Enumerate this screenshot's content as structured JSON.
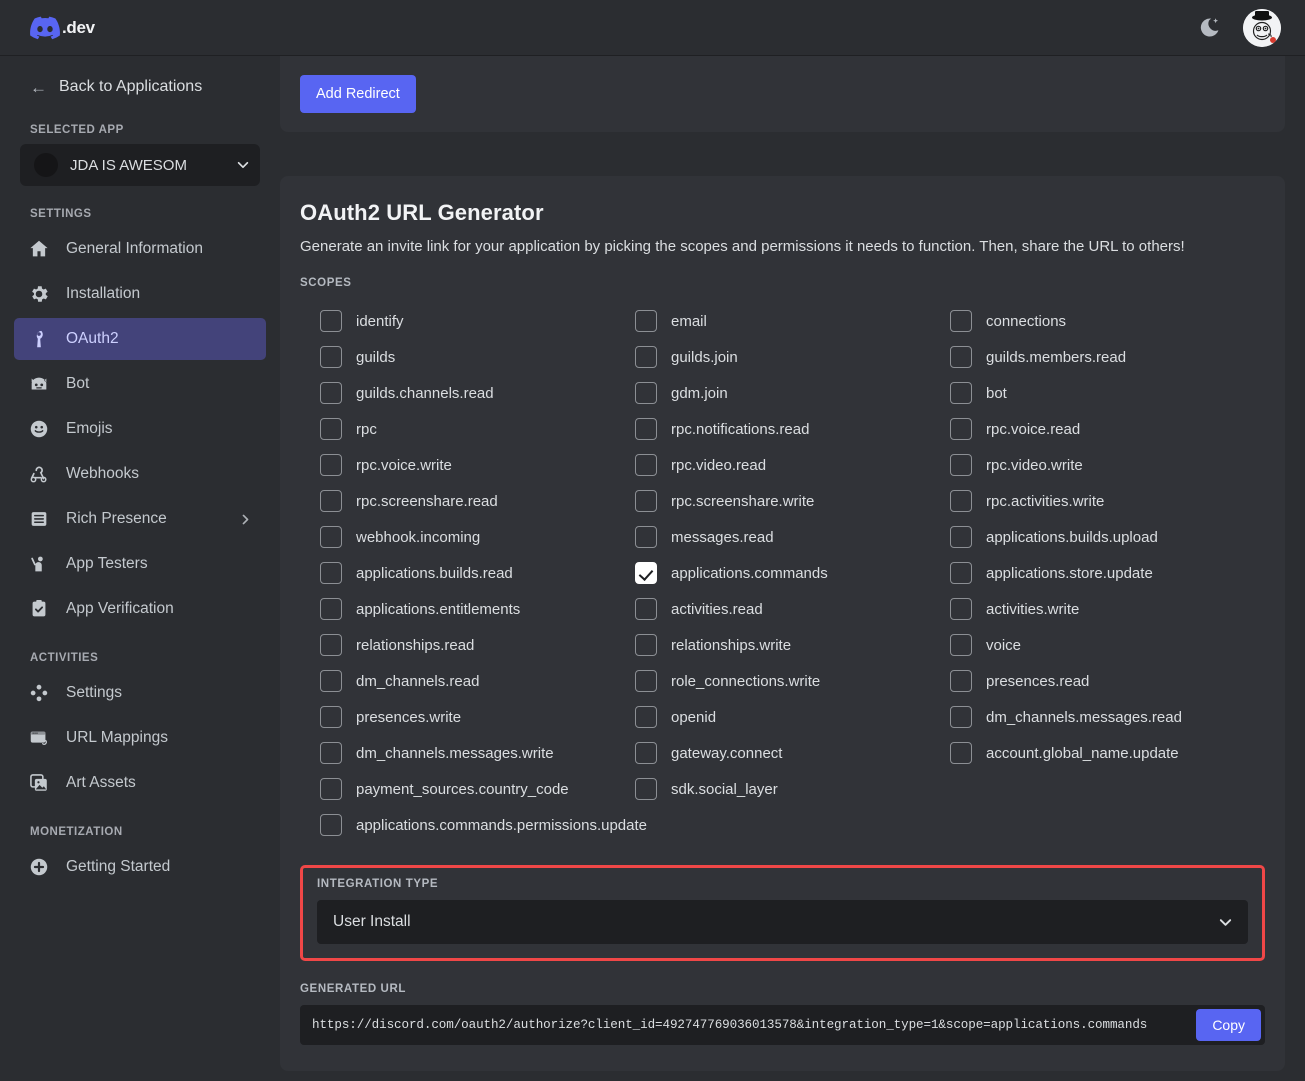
{
  "topbar": {
    "brand_suffix": ".dev",
    "logo_icon": "discord-logo-icon",
    "theme_toggle_icon": "moon-icon",
    "avatar_icon": "user-avatar"
  },
  "sidebar": {
    "back_label": "Back to Applications",
    "back_icon": "arrow-left-icon",
    "selected_app_heading": "SELECTED APP",
    "selected_app_name": "JDA IS AWESOM",
    "settings_heading": "SETTINGS",
    "settings_items": [
      {
        "label": "General Information",
        "icon": "home-icon",
        "active": false
      },
      {
        "label": "Installation",
        "icon": "gear-icon",
        "active": false
      },
      {
        "label": "OAuth2",
        "icon": "wrench-icon",
        "active": true
      },
      {
        "label": "Bot",
        "icon": "bot-icon",
        "active": false
      },
      {
        "label": "Emojis",
        "icon": "smiley-icon",
        "active": false
      },
      {
        "label": "Webhooks",
        "icon": "webhook-icon",
        "active": false
      },
      {
        "label": "Rich Presence",
        "icon": "list-icon",
        "active": false,
        "expandable": true
      },
      {
        "label": "App Testers",
        "icon": "person-raise-hand-icon",
        "active": false
      },
      {
        "label": "App Verification",
        "icon": "clipboard-check-icon",
        "active": false
      }
    ],
    "activities_heading": "ACTIVITIES",
    "activities_items": [
      {
        "label": "Settings",
        "icon": "dpad-icon"
      },
      {
        "label": "URL Mappings",
        "icon": "browser-link-icon"
      },
      {
        "label": "Art Assets",
        "icon": "image-icon"
      }
    ],
    "monetization_heading": "MONETIZATION",
    "monetization_items": [
      {
        "label": "Getting Started",
        "icon": "plus-circle-icon"
      }
    ]
  },
  "main": {
    "add_redirect_label": "Add Redirect",
    "generator_title": "OAuth2 URL Generator",
    "generator_subtitle": "Generate an invite link for your application by picking the scopes and permissions it needs to function. Then, share the URL to others!",
    "scopes_label": "SCOPES",
    "scopes": [
      {
        "name": "identify",
        "checked": false
      },
      {
        "name": "email",
        "checked": false
      },
      {
        "name": "connections",
        "checked": false
      },
      {
        "name": "guilds",
        "checked": false
      },
      {
        "name": "guilds.join",
        "checked": false
      },
      {
        "name": "guilds.members.read",
        "checked": false
      },
      {
        "name": "guilds.channels.read",
        "checked": false
      },
      {
        "name": "gdm.join",
        "checked": false
      },
      {
        "name": "bot",
        "checked": false
      },
      {
        "name": "rpc",
        "checked": false
      },
      {
        "name": "rpc.notifications.read",
        "checked": false
      },
      {
        "name": "rpc.voice.read",
        "checked": false
      },
      {
        "name": "rpc.voice.write",
        "checked": false
      },
      {
        "name": "rpc.video.read",
        "checked": false
      },
      {
        "name": "rpc.video.write",
        "checked": false
      },
      {
        "name": "rpc.screenshare.read",
        "checked": false
      },
      {
        "name": "rpc.screenshare.write",
        "checked": false
      },
      {
        "name": "rpc.activities.write",
        "checked": false
      },
      {
        "name": "webhook.incoming",
        "checked": false
      },
      {
        "name": "messages.read",
        "checked": false
      },
      {
        "name": "applications.builds.upload",
        "checked": false
      },
      {
        "name": "applications.builds.read",
        "checked": false
      },
      {
        "name": "applications.commands",
        "checked": true
      },
      {
        "name": "applications.store.update",
        "checked": false
      },
      {
        "name": "applications.entitlements",
        "checked": false
      },
      {
        "name": "activities.read",
        "checked": false
      },
      {
        "name": "activities.write",
        "checked": false
      },
      {
        "name": "relationships.read",
        "checked": false
      },
      {
        "name": "relationships.write",
        "checked": false
      },
      {
        "name": "voice",
        "checked": false
      },
      {
        "name": "dm_channels.read",
        "checked": false
      },
      {
        "name": "role_connections.write",
        "checked": false
      },
      {
        "name": "presences.read",
        "checked": false
      },
      {
        "name": "presences.write",
        "checked": false
      },
      {
        "name": "openid",
        "checked": false
      },
      {
        "name": "dm_channels.messages.read",
        "checked": false
      },
      {
        "name": "dm_channels.messages.write",
        "checked": false
      },
      {
        "name": "gateway.connect",
        "checked": false
      },
      {
        "name": "account.global_name.update",
        "checked": false
      },
      {
        "name": "payment_sources.country_code",
        "checked": false
      },
      {
        "name": "sdk.social_layer",
        "checked": false
      }
    ],
    "scope_wide": {
      "name": "applications.commands.permissions.update",
      "checked": false
    },
    "integration_type_label": "INTEGRATION TYPE",
    "integration_type_value": "User Install",
    "generated_url_label": "GENERATED URL",
    "generated_url": "https://discord.com/oauth2/authorize?client_id=492747769036013578&integration_type=1&scope=applications.commands",
    "copy_label": "Copy",
    "highlight_color": "#f04747",
    "accent_color": "#5865f2"
  }
}
